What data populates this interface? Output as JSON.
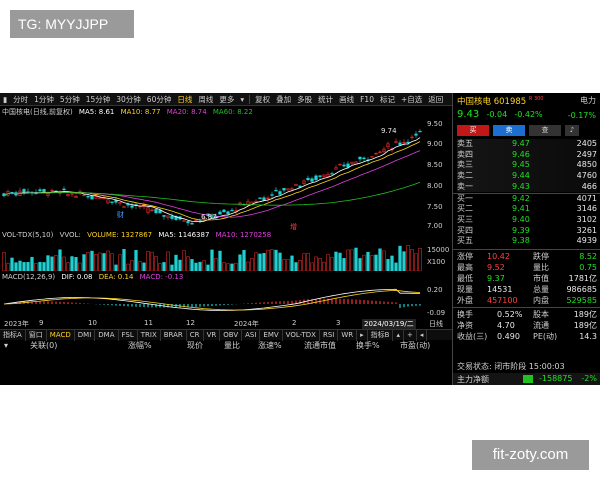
{
  "watermark": {
    "top": "TG: MYYJJPP",
    "bottom": "fit-zoty.com"
  },
  "toolbar": {
    "items": [
      "分时",
      "1分钟",
      "5分钟",
      "15分钟",
      "30分钟",
      "60分钟",
      "日线",
      "周线",
      "更多"
    ],
    "active": "日线",
    "tools": [
      "复权",
      "叠加",
      "多股",
      "统计",
      "画线",
      "F10",
      "标记",
      "+自选",
      "返回"
    ]
  },
  "main_legend": {
    "title": "中国核电(日线,前复权)",
    "ma5": "MA5: 8.61",
    "ma10": "MA10: 8.77",
    "ma20": "MA20: 8.74",
    "ma60": "MA60: 8.22",
    "colors": {
      "ma5": "#ffffff",
      "ma10": "#ffd21e",
      "ma20": "#e040e0",
      "ma60": "#20c020"
    }
  },
  "price_axis": [
    "9.50",
    "9.00",
    "8.50",
    "8.00",
    "7.50",
    "7.00"
  ],
  "annotations": {
    "high": "9.74",
    "low": "6.87",
    "mark_cai": "财",
    "mark_zeng": "增"
  },
  "vol_legend": {
    "title": "VOL-TDX(5,10)",
    "vvol": "VVOL:",
    "volume": "VOLUME: 1327867",
    "ma5": "MA5: 1146387",
    "ma10": "MA10: 1270258"
  },
  "vol_axis": {
    "top": "15000",
    "unit": "X100"
  },
  "macd_legend": {
    "title": "MACD(12,26,9)",
    "dif": "DIF: 0.08",
    "dea": "DEA: 0.14",
    "macd": "MACD: -0.13"
  },
  "macd_axis": [
    "0.20",
    "-0.09"
  ],
  "dates": [
    "2023年",
    "9",
    "10",
    "11",
    "12",
    "2024年",
    "2",
    "3",
    "2024/03/19/二",
    "日线"
  ],
  "bottom_tabs": [
    "指标A",
    "窗口",
    "MACD",
    "DMI",
    "DMA",
    "FSL",
    "TRIX",
    "BRAR",
    "CR",
    "VR",
    "OBV",
    "ASI",
    "EMV",
    "VOL-TDX",
    "RSI",
    "WR",
    "指标B"
  ],
  "active_tab": "MACD",
  "col_headers": [
    "关联(0)",
    "涨幅%",
    "现价",
    "量比",
    "涨速%",
    "流通市值",
    "换手%",
    "市盈(动)"
  ],
  "panel": {
    "name": "中国核电",
    "code": "601985",
    "tag": "R 300",
    "sector": "电力",
    "price": "9.43",
    "change": "-0.04",
    "change_pct": "-0.42%",
    "pct_right": "-0.17%",
    "buttons": {
      "buy": "买",
      "sell": "卖",
      "look": "查",
      "bell": "🔔"
    },
    "sell_orders": [
      {
        "label": "卖五",
        "price": "9.47",
        "vol": "2405"
      },
      {
        "label": "卖四",
        "price": "9.46",
        "vol": "2497"
      },
      {
        "label": "卖三",
        "price": "9.45",
        "vol": "4850"
      },
      {
        "label": "卖二",
        "price": "9.44",
        "vol": "4760"
      },
      {
        "label": "卖一",
        "price": "9.43",
        "vol": "466"
      }
    ],
    "buy_orders": [
      {
        "label": "买一",
        "price": "9.42",
        "vol": "4071"
      },
      {
        "label": "买二",
        "price": "9.41",
        "vol": "3146"
      },
      {
        "label": "买三",
        "price": "9.40",
        "vol": "3102"
      },
      {
        "label": "买四",
        "price": "9.39",
        "vol": "3261"
      },
      {
        "label": "买五",
        "price": "9.38",
        "vol": "4939"
      }
    ],
    "stats": [
      {
        "l1": "涨停",
        "v1": "10.42",
        "c1": "#ff4040",
        "l2": "跌停",
        "v2": "8.52",
        "c2": "#20e020"
      },
      {
        "l1": "最高",
        "v1": "9.52",
        "c1": "#ff4040",
        "l2": "量比",
        "v2": "0.75",
        "c2": "#20e020"
      },
      {
        "l1": "最低",
        "v1": "9.37",
        "c1": "#20e020",
        "l2": "市值",
        "v2": "1781亿",
        "c2": "#e8e8e8"
      },
      {
        "l1": "现量",
        "v1": "14531",
        "c1": "#e8e8e8",
        "l2": "总量",
        "v2": "986685",
        "c2": "#e8e8e8"
      },
      {
        "l1": "外盘",
        "v1": "457100",
        "c1": "#ff4040",
        "l2": "内盘",
        "v2": "529585",
        "c2": "#20e020"
      }
    ],
    "stats2": [
      {
        "l1": "换手",
        "v1": "0.52%",
        "l2": "股本",
        "v2": "189亿"
      },
      {
        "l1": "净资",
        "v1": "4.70",
        "l2": "流通",
        "v2": "189亿"
      },
      {
        "l1": "收益(三)",
        "v1": "0.490",
        "l2": "PE(动)",
        "v2": "14.3"
      }
    ],
    "status": "交易状态: 闭市阶段 15:00:03",
    "flow_label": "主力净额",
    "flow_value": "-158875",
    "flow_pct": "-2%"
  }
}
